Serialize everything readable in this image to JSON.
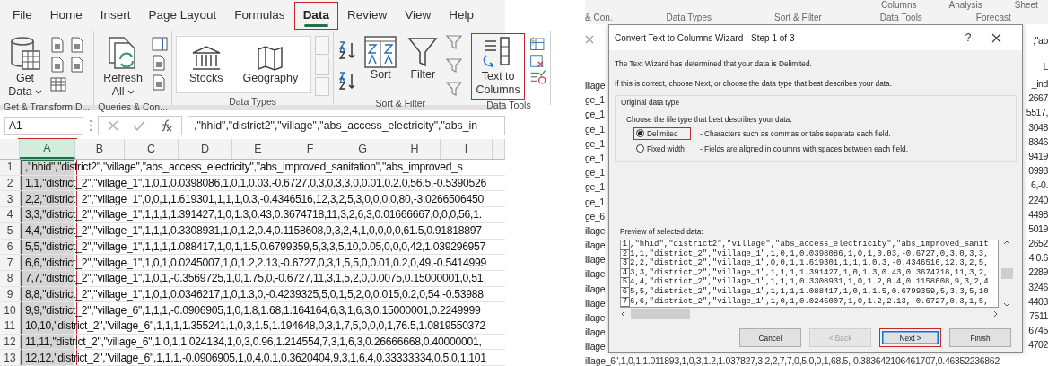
{
  "excel": {
    "tabs": [
      {
        "label": "File",
        "selected": false,
        "highlighted": false
      },
      {
        "label": "Home",
        "selected": false,
        "highlighted": false
      },
      {
        "label": "Insert",
        "selected": false,
        "highlighted": false
      },
      {
        "label": "Page Layout",
        "selected": false,
        "highlighted": false
      },
      {
        "label": "Formulas",
        "selected": false,
        "highlighted": false
      },
      {
        "label": "Data",
        "selected": true,
        "highlighted": true
      },
      {
        "label": "Review",
        "selected": false,
        "highlighted": false
      },
      {
        "label": "View",
        "selected": false,
        "highlighted": false
      },
      {
        "label": "Help",
        "selected": false,
        "highlighted": false
      }
    ],
    "ribbon_groups": [
      {
        "kind": "get",
        "label": "Get & Transform D...",
        "buttons": [
          {
            "label": "Get Data",
            "highlighted": false
          }
        ]
      },
      {
        "kind": "queries",
        "label": "Queries & Con...",
        "buttons": [
          {
            "label": "Refresh All",
            "highlighted": false
          }
        ]
      },
      {
        "kind": "types",
        "label": "Data Types",
        "buttons": [
          {
            "label": "Stocks",
            "highlighted": false
          },
          {
            "label": "Geography",
            "highlighted": false
          }
        ]
      },
      {
        "kind": "sort",
        "label": "Sort & Filter",
        "buttons": [
          {
            "label": "Sort",
            "highlighted": false
          },
          {
            "label": "Filter",
            "highlighted": false
          }
        ]
      },
      {
        "kind": "tools",
        "label": "Data Tools",
        "buttons": [
          {
            "label": "Text to Columns",
            "highlighted": true
          }
        ]
      }
    ],
    "name_box": "A1",
    "formula": ",\"hhid\",\"district2\",\"village\",\"abs_access_electricity\",\"abs_in",
    "columns": [
      {
        "label": "A",
        "selected": true,
        "highlighted": true
      },
      {
        "label": "B",
        "selected": false,
        "highlighted": false
      },
      {
        "label": "C",
        "selected": false,
        "highlighted": false
      },
      {
        "label": "D",
        "selected": false,
        "highlighted": false
      },
      {
        "label": "E",
        "selected": false,
        "highlighted": false
      },
      {
        "label": "F",
        "selected": false,
        "highlighted": false
      },
      {
        "label": "G",
        "selected": false,
        "highlighted": false
      },
      {
        "label": "H",
        "selected": false,
        "highlighted": false
      },
      {
        "label": "I",
        "selected": false,
        "highlighted": false
      }
    ],
    "rows": [
      {
        "number": "1",
        "text": ",\"hhid\",\"district2\",\"village\",\"abs_access_electricity\",\"abs_improved_sanitation\",\"abs_improved_s"
      },
      {
        "number": "2",
        "text": "1,1,\"district_2\",\"village_1\",1,0,1,0.0398086,1,0,1,0.03,-0.6727,0,3,0,3,3,0,0.01,0.2,0,56.5,-0.5390526"
      },
      {
        "number": "3",
        "text": "2,2,\"district_2\",\"village_1\",0,0,1,1.619301,1,1,1,0.3,-0.4346516,12,3,2,5,3,0,0,0,0,80,-3.0266506450"
      },
      {
        "number": "4",
        "text": "3,3,\"district_2\",\"village_1\",1,1,1,1.391427,1,0,1.3,0.43,0.3674718,11,3,2,6,3,0.01666667,0,0,0,56,1."
      },
      {
        "number": "5",
        "text": "4,4,\"district_2\",\"village_1\",1,1,1,0.3308931,1,0,1.2,0.4,0.1158608,9,3,2,4,1,0,0,0,0,61.5,0.91818897"
      },
      {
        "number": "6",
        "text": "5,5,\"district_2\",\"village_1\",1,1,1,1.088417,1,0,1,1.5,0.6799359,5,3,3,5,10,0.05,0,0,0,42,1.039296957"
      },
      {
        "number": "7",
        "text": "6,6,\"district_2\",\"village_1\",1,0,1,0.0245007,1,0,1.2,2.13,-0.6727,0,3,1,5,5,0,0.01,0.2,0,49,-0.5414999"
      },
      {
        "number": "8",
        "text": "7,7,\"district_2\",\"village_1\",1,0,1,-0.3569725,1,0,1.75,0,-0.6727,11,3,1,5,2,0,0.0075,0.15000001,0,51"
      },
      {
        "number": "9",
        "text": "8,8,\"district_2\",\"village_1\",1,0,1,0.0346217,1,0,1.3,0,-0.4239325,5,0,1,5,2,0,0.015,0.2,0,54,-0.53988"
      },
      {
        "number": "10",
        "text": "9,9,\"district_2\",\"village_6\",1,1,1,-0.0906905,1,0,1.8,1.68,1.164164,6,3,1,6,3,0.15000001,0.2249999"
      },
      {
        "number": "11",
        "text": "10,10,\"district_2\",\"village_6\",1,1,1,1.355241,1,0,3,1.5,1.194648,0,3,1,7,5,0,0,0,1,76.5,1.0819550372"
      },
      {
        "number": "12",
        "text": "11,11,\"district_2\",\"village_6\",1,0,1,1.024134,1,0,3,0.96,1.214554,7,3,1,6,3,0.26666668,0.40000001,"
      },
      {
        "number": "13",
        "text": "12,12,\"district_2\",\"village_6\",1,1,1,-0.0906905,1,0,4,0.1,0.3620404,9,3,1,6,4,0.33333334,0.5,0,1,101"
      }
    ]
  },
  "background": {
    "ribbon_top": [
      "Columns",
      "Analysis",
      "Sheet"
    ],
    "ribbon_groups": [
      "& Con.",
      "Data Types",
      "Sort & Filter",
      "Data Tools",
      "Forecast"
    ],
    "formula_fragment": ",\"ab",
    "header_fragment": "L",
    "left_cells": [
      "illage",
      "ge_1",
      "ge_1",
      "ge_1",
      "ge_1",
      "ge_1",
      "ge_1",
      "ge_1",
      "ge_1",
      "ge_6",
      "illage",
      "illage",
      "illage",
      "illage",
      "illage",
      "illage",
      "illage",
      "illage",
      "illage"
    ],
    "right_cells": [
      "_ind",
      "2667",
      "5517,",
      "3048",
      "8846",
      "9419",
      "0998",
      "6,-0.",
      "2240",
      "4498",
      "5019",
      "2652",
      "4,0.6",
      "2289",
      "3246",
      "4403",
      "7511",
      "6745",
      "4702"
    ],
    "bottom_row": "illage_6\",1,0,1,1.011893,1,0,3,1.2,1.037827,3,2,2,7,7,0,5,0,0,1,68.5,-0.383642106461707,0.46352236862"
  },
  "dialog": {
    "title": "Convert Text to Columns Wizard - Step 1 of 3",
    "help": "?",
    "intro": "The Text Wizard has determined that your data is Delimited.",
    "hint": "If this is correct, choose Next, or choose the data type that best describes your data.",
    "group_title": "Original data type",
    "group_prompt": "Choose the file type that best describes your data:",
    "options": [
      {
        "label": "Delimited",
        "description": "- Characters such as commas or tabs separate each field.",
        "selected": true,
        "highlighted": true
      },
      {
        "label": "Fixed width",
        "description": "- Fields are aligned in columns with spaces between each field.",
        "selected": false,
        "highlighted": false
      }
    ],
    "preview_label": "Preview of selected data:",
    "preview": [
      {
        "number": "1",
        "text": ",\"hhid\",\"district2\",\"village\",\"abs_access_electricity\",\"abs_improved_sanit"
      },
      {
        "number": "2",
        "text": "1,1,\"district_2\",\"village_1\",1,0,1,0.0398086,1,0,1,0.03,-0.6727,0,3,0,3,3,"
      },
      {
        "number": "3",
        "text": "2,2,\"district_2\",\"village_1\",0,0,1,1.619301,1,1,1,0.3,-0.4346516,12,3,2,5,"
      },
      {
        "number": "4",
        "text": "3,3,\"district_2\",\"village_1\",1,1,1,1.391427,1,0,1.3,0.43,0.3674718,11,3,2,"
      },
      {
        "number": "5",
        "text": "4,4,\"district_2\",\"village_1\",1,1,1,0.3308931,1,0,1.2,0.4,0.1158608,9,3,2,4"
      },
      {
        "number": "6",
        "text": "5,5,\"district_2\",\"village_1\",1,1,1,1.088417,1,0,1,1.5,0.6799359,5,3,3,5,10"
      },
      {
        "number": "7",
        "text": "6,6,\"district_2\",\"village_1\",1,0,1,0.0245007,1,0,1.2,2.13,-0.6727,0,3,1,5,"
      }
    ],
    "buttons": [
      {
        "label": "Cancel",
        "disabled": false,
        "default": false,
        "highlighted": false
      },
      {
        "label": "< Back",
        "disabled": true,
        "default": false,
        "highlighted": false
      },
      {
        "label": "Next >",
        "disabled": false,
        "default": true,
        "highlighted": true
      },
      {
        "label": "Finish",
        "disabled": false,
        "default": false,
        "highlighted": false
      }
    ]
  }
}
